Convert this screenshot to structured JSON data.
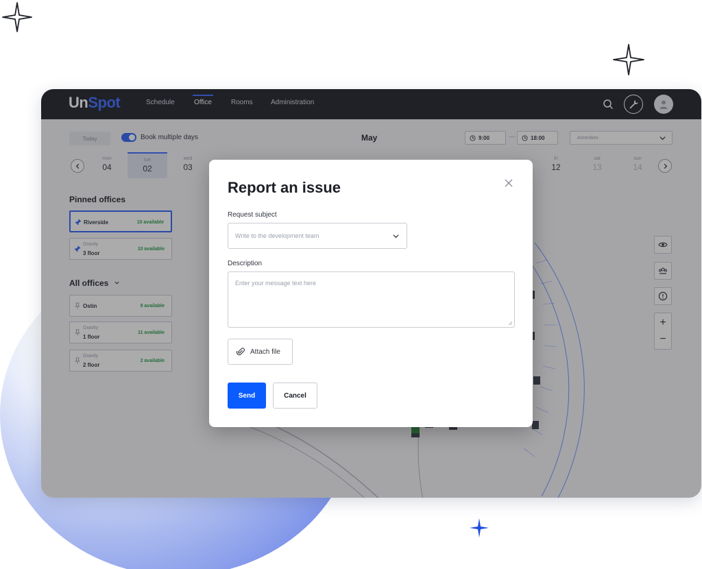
{
  "app": {
    "logo_a": "Un",
    "logo_b": "Spot",
    "brand_color": "#3d6bff"
  },
  "nav": {
    "items": [
      {
        "label": "Schedule"
      },
      {
        "label": "Office"
      },
      {
        "label": "Rooms"
      },
      {
        "label": "Administration"
      }
    ],
    "active": "Office",
    "icons": [
      "search-icon",
      "wrench-icon",
      "user-avatar-icon"
    ]
  },
  "toolbar": {
    "today": "Today",
    "book_multiple": "Book multiple days",
    "book_multiple_enabled": true,
    "month": "May",
    "time_from": "9:00",
    "time_separator": "—",
    "time_to": "18:00",
    "amenities_placeholder": "Amenities"
  },
  "calendar": {
    "days": [
      {
        "name": "mon",
        "date": "04"
      },
      {
        "name": "tue",
        "date": "02"
      },
      {
        "name": "wed",
        "date": "03"
      },
      {
        "name": "fri",
        "date": "12"
      },
      {
        "name": "sat",
        "date": "13"
      },
      {
        "name": "sun",
        "date": "14"
      }
    ],
    "selected": "tue"
  },
  "pinned": {
    "title": "Pinned offices",
    "items": [
      {
        "name": "Riverside",
        "sub": "",
        "available": "10 available"
      },
      {
        "name": "3 floor",
        "sub": "Gravity",
        "available": "10 available"
      }
    ]
  },
  "all_offices": {
    "title": "All offices",
    "items": [
      {
        "name": "Ostin",
        "sub": "",
        "available": "9 available"
      },
      {
        "name": "1 floor",
        "sub": "Gravity",
        "available": "11 available"
      },
      {
        "name": "2 floor",
        "sub": "Gravity",
        "available": "2 available"
      }
    ]
  },
  "map_tools": {
    "zoom_in": "+",
    "zoom_out": "−"
  },
  "modal": {
    "title": "Report an issue",
    "subject_label": "Request subject",
    "subject_placeholder": "Write to the development team",
    "description_label": "Description",
    "description_placeholder": "Enter your message text here",
    "attach": "Attach file",
    "send": "Send",
    "cancel": "Cancel",
    "send_color": "#0b5cff"
  }
}
